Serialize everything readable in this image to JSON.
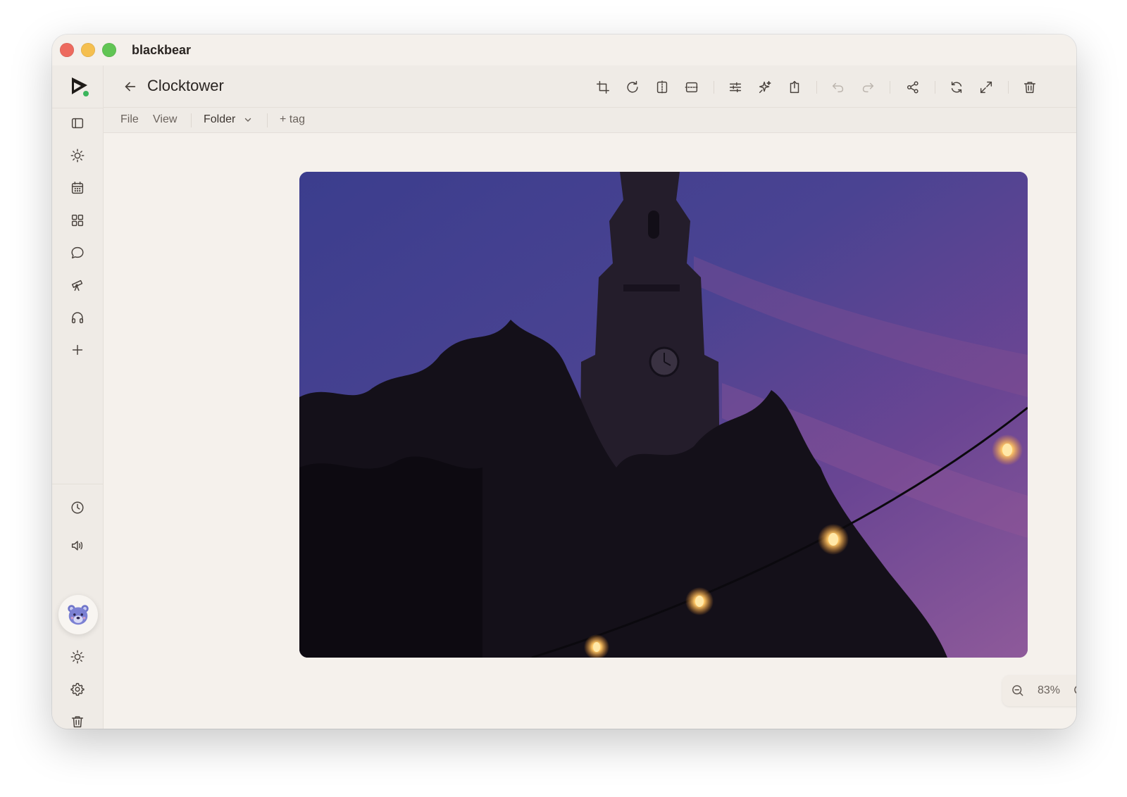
{
  "window": {
    "app_title": "blackbear"
  },
  "header": {
    "title": "Clocktower"
  },
  "menubar": {
    "file": "File",
    "view": "View",
    "folder": "Folder",
    "tag": "+ tag"
  },
  "zoom": {
    "level": "83%"
  },
  "colors": {
    "window_bg": "#f4f0eb",
    "sidebar_bg": "#efebe6",
    "icon": "#4a433e",
    "icon_disabled": "#bcb5ae",
    "logo_dot": "#3bb55c"
  },
  "sidebar": {
    "top_icons": [
      "sidebar-toggle-icon",
      "sun-icon",
      "calendar-icon",
      "grid-icon",
      "chat-icon",
      "telescope-icon",
      "headphones-icon",
      "plus-icon"
    ],
    "bottom_icons": [
      "clock-icon",
      "speaker-icon",
      "bear-avatar",
      "sun-icon",
      "gear-icon",
      "trash-icon"
    ]
  },
  "toolbar_icons": [
    "crop-icon",
    "rotate-icon",
    "flip-horizontal-icon",
    "flip-vertical-icon",
    "sliders-icon",
    "sparkle-icon",
    "export-icon",
    "undo-icon",
    "redo-icon",
    "share-icon",
    "refresh-icon",
    "expand-icon",
    "trash-icon"
  ]
}
